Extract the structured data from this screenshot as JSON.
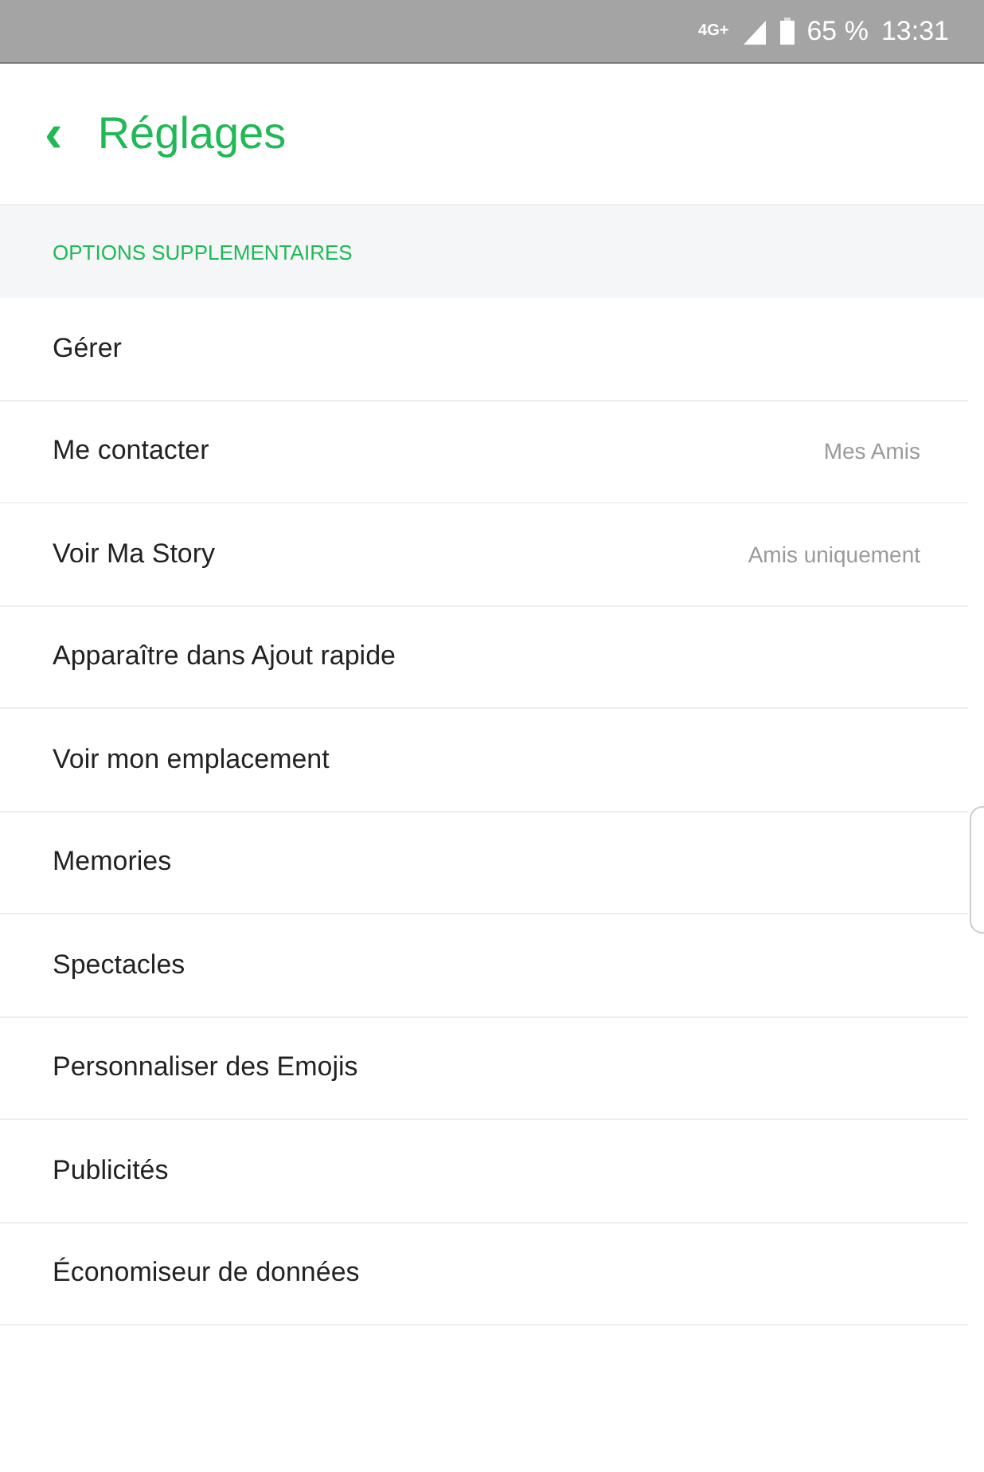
{
  "status_bar": {
    "network": "4G+",
    "battery": "65 %",
    "time": "13:31"
  },
  "header": {
    "back_icon": "‹",
    "title": "Réglages"
  },
  "section": {
    "title": "OPTIONS SUPPLEMENTAIRES",
    "items": [
      {
        "label": "Gérer"
      },
      {
        "label": "Me contacter",
        "value": "Mes Amis"
      },
      {
        "label": "Voir Ma Story",
        "value": "Amis uniquement"
      },
      {
        "label": "Apparaître dans Ajout rapide"
      },
      {
        "label": "Voir mon emplacement"
      },
      {
        "label": "Memories"
      },
      {
        "label": "Spectacles"
      },
      {
        "label": "Personnaliser des Emojis"
      },
      {
        "label": "Publicités"
      },
      {
        "label": "Économiseur de données"
      }
    ]
  }
}
